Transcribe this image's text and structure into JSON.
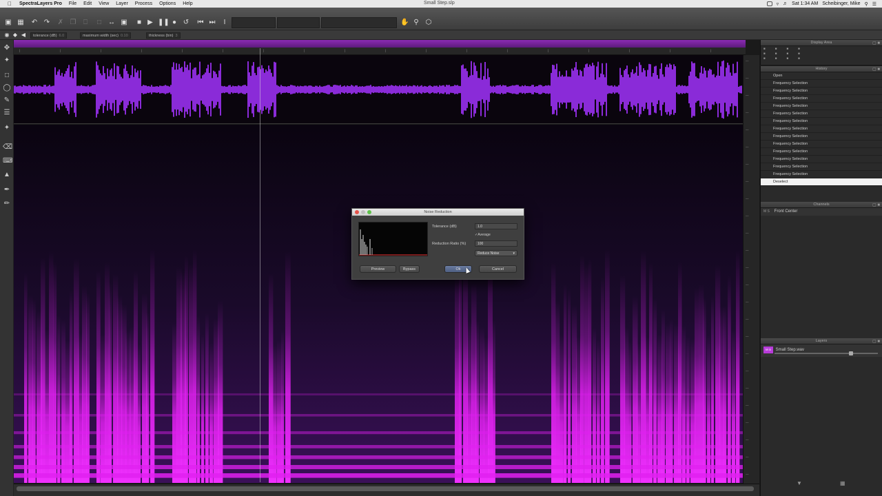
{
  "menubar": {
    "app_name": "SpectraLayers Pro",
    "menus": [
      "File",
      "Edit",
      "View",
      "Layer",
      "Process",
      "Options",
      "Help"
    ],
    "document_title": "Small Step.slp",
    "clock": "Sat 1:34 AM",
    "user": "Scheibinger, Mike"
  },
  "options_bar": {
    "tolerance_label": "tolerance (dB)",
    "tolerance_value": "6.0",
    "max_width_label": "maximum width (sec)",
    "max_width_value": "0.10",
    "thickness_label": "thickness (bin)",
    "thickness_value": "3"
  },
  "panels": {
    "display_area_title": "Display Area",
    "history_title": "History",
    "channels_title": "Channels",
    "layers_title": "Layers"
  },
  "history": {
    "items": [
      "Open",
      "Frequency Selection",
      "Frequency Selection",
      "Frequency Selection",
      "Frequency Selection",
      "Frequency Selection",
      "Frequency Selection",
      "Frequency Selection",
      "Frequency Selection",
      "Frequency Selection",
      "Frequency Selection",
      "Frequency Selection",
      "Frequency Selection",
      "Frequency Selection",
      "Deselect"
    ],
    "selected_index": 14
  },
  "channels": {
    "items": [
      {
        "ms": "M S",
        "name": "Front Center"
      }
    ]
  },
  "layers": {
    "items": [
      {
        "ms": "M S",
        "name": "Small Step.wav"
      }
    ]
  },
  "dialog": {
    "title": "Noise Reduction",
    "tolerance_label": "Tolerance (dB)",
    "tolerance_value": "1.0",
    "average_label": "Average",
    "reduction_ratio_label": "Reduction Ratio (%)",
    "reduction_ratio_value": "100",
    "mode_value": "Reduce Noise",
    "preview_label": "Preview",
    "bypass_label": "Bypass",
    "ok_label": "Ok",
    "cancel_label": "Cancel"
  },
  "colors": {
    "spectrogram_accent": "#e020f0",
    "waveform": "#8a2bd8",
    "timeline_bar": "#8a2bb3"
  }
}
